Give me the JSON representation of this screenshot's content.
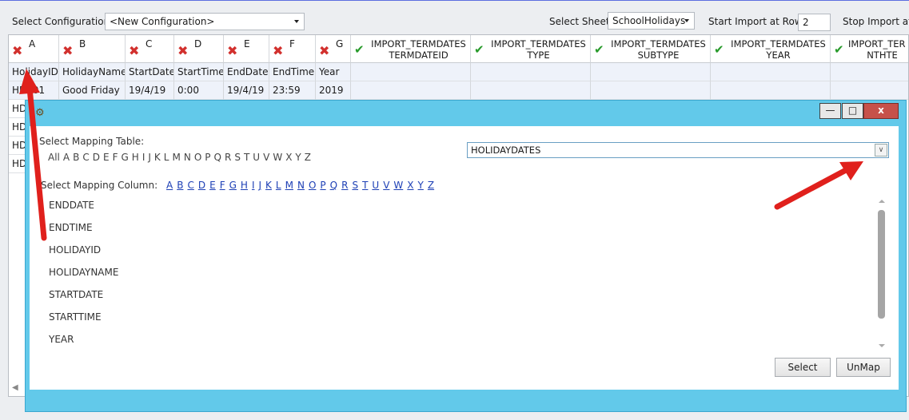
{
  "toolbar": {
    "select_config_label": "Select Configuration",
    "config_value": "<New Configuration>",
    "select_sheet_label": "Select Sheet",
    "sheet_value": "SchoolHolidays",
    "start_import_label": "Start Import at Row:",
    "start_import_value": "2",
    "stop_import_label": "Stop Import at"
  },
  "grid": {
    "columns": [
      {
        "letter": "A",
        "mapped": false,
        "field": "HolidayID"
      },
      {
        "letter": "B",
        "mapped": false,
        "field": "HolidayName"
      },
      {
        "letter": "C",
        "mapped": false,
        "field": "StartDate"
      },
      {
        "letter": "D",
        "mapped": false,
        "field": "StartTime"
      },
      {
        "letter": "E",
        "mapped": false,
        "field": "EndDate"
      },
      {
        "letter": "F",
        "mapped": false,
        "field": "EndTime"
      },
      {
        "letter": "G",
        "mapped": false,
        "field": "Year"
      }
    ],
    "import_columns": [
      {
        "line1": "IMPORT_TERMDATES",
        "line2": "TERMDATEID"
      },
      {
        "line1": "IMPORT_TERMDATES",
        "line2": "TYPE"
      },
      {
        "line1": "IMPORT_TERMDATES",
        "line2": "SUBTYPE"
      },
      {
        "line1": "IMPORT_TERMDATES",
        "line2": "YEAR"
      },
      {
        "line1": "IMPORT_TER",
        "line2": "NTHTE"
      }
    ],
    "first_row": [
      "HD001",
      "Good Friday",
      "19/4/19",
      "0:00",
      "19/4/19",
      "23:59",
      "2019"
    ],
    "partial_rows": [
      "HD",
      "HD",
      "HD",
      "HD"
    ]
  },
  "dialog": {
    "select_table_label": "Select Mapping Table:",
    "table_letters": [
      "All",
      "A",
      "B",
      "C",
      "D",
      "E",
      "F",
      "G",
      "H",
      "I",
      "J",
      "K",
      "L",
      "M",
      "N",
      "O",
      "P",
      "Q",
      "R",
      "S",
      "T",
      "U",
      "V",
      "W",
      "X",
      "Y",
      "Z"
    ],
    "table_value": "HOLIDAYDATES",
    "select_column_label": "Select Mapping Column:",
    "column_letters": [
      "A",
      "B",
      "C",
      "D",
      "E",
      "F",
      "G",
      "H",
      "I",
      "J",
      "K",
      "L",
      "M",
      "N",
      "O",
      "P",
      "Q",
      "R",
      "S",
      "T",
      "U",
      "V",
      "W",
      "X",
      "Y",
      "Z"
    ],
    "columns": [
      "ENDDATE",
      "ENDTIME",
      "HOLIDAYID",
      "HOLIDAYNAME",
      "STARTDATE",
      "STARTTIME",
      "YEAR"
    ],
    "select_button": "Select",
    "unmap_button": "UnMap",
    "minimize_glyph": "—",
    "maximize_glyph": "□",
    "close_glyph": "x"
  },
  "colors": {
    "dialog_bg": "#62c9ea",
    "close_button": "#c7514a",
    "unmapped_icon": "#d2302d",
    "mapped_icon": "#279a2a",
    "annotation_arrow": "#e0201c"
  }
}
